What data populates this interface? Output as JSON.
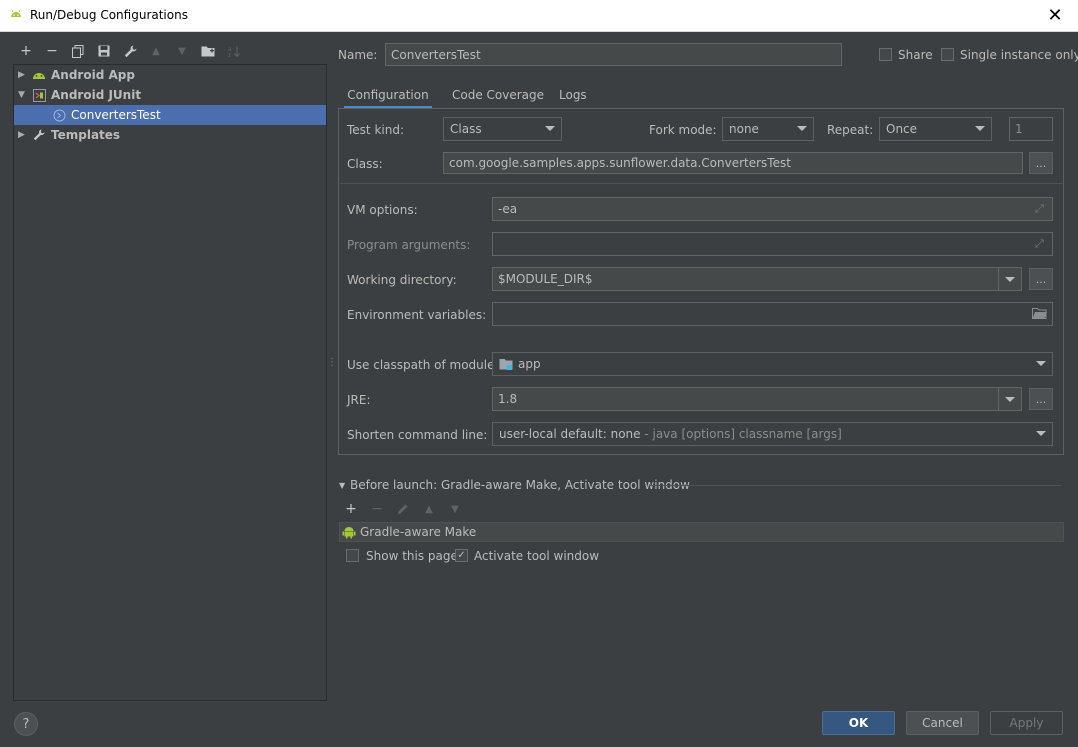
{
  "window": {
    "title": "Run/Debug Configurations",
    "close_glyph": "✕"
  },
  "toolbar": {
    "add": "+",
    "remove": "−",
    "copy_icon": "copy-icon",
    "save_icon": "save-icon",
    "edit_defaults_icon": "wrench-icon",
    "move_up": "▲",
    "move_down": "▼",
    "folder_icon": "folder-icon",
    "sort_icon": "sort-icon"
  },
  "tree": {
    "items": [
      {
        "label": "Android App",
        "expanded": false,
        "bold": true
      },
      {
        "label": "Android JUnit",
        "expanded": true,
        "bold": true
      },
      {
        "label": "ConvertersTest",
        "selected": true
      },
      {
        "label": "Templates",
        "expanded": false,
        "bold": true
      }
    ]
  },
  "name_row": {
    "label": "Name:",
    "value": "ConvertersTest",
    "share_label": "Share",
    "single_instance_label": "Single instance only"
  },
  "tabs": [
    {
      "label": "Configuration",
      "active": true
    },
    {
      "label": "Code Coverage",
      "active": false
    },
    {
      "label": "Logs",
      "active": false
    }
  ],
  "config": {
    "test_kind_label": "Test kind:",
    "test_kind_value": "Class",
    "fork_mode_label": "Fork mode:",
    "fork_mode_value": "none",
    "repeat_label": "Repeat:",
    "repeat_value": "Once",
    "repeat_count": "1",
    "class_label": "Class:",
    "class_value": "com.google.samples.apps.sunflower.data.ConvertersTest",
    "browse": "...",
    "vm_options_label": "VM options:",
    "vm_options_value": "-ea",
    "program_args_label": "Program arguments:",
    "program_args_value": "",
    "working_dir_label": "Working directory:",
    "working_dir_value": "$MODULE_DIR$",
    "env_vars_label": "Environment variables:",
    "env_vars_value": "",
    "classpath_label": "Use classpath of module:",
    "classpath_value": "app",
    "jre_label": "JRE:",
    "jre_value": "1.8",
    "shorten_label": "Shorten command line:",
    "shorten_value": "user-local default: none",
    "shorten_hint": " - java [options] classname [args]"
  },
  "before_launch": {
    "header": "Before launch: Gradle-aware Make, Activate tool window",
    "tasks": [
      {
        "label": "Gradle-aware Make"
      }
    ],
    "show_page_label": "Show this page",
    "show_page_checked": false,
    "activate_label": "Activate tool window",
    "activate_checked": true
  },
  "footer": {
    "help": "?",
    "ok": "OK",
    "cancel": "Cancel",
    "apply": "Apply"
  },
  "colors": {
    "background": "#3c3f41",
    "selection": "#4b6eaf",
    "primary_button": "#365880",
    "android_green": "#a4c639",
    "tab_underline": "#4a88c7"
  }
}
